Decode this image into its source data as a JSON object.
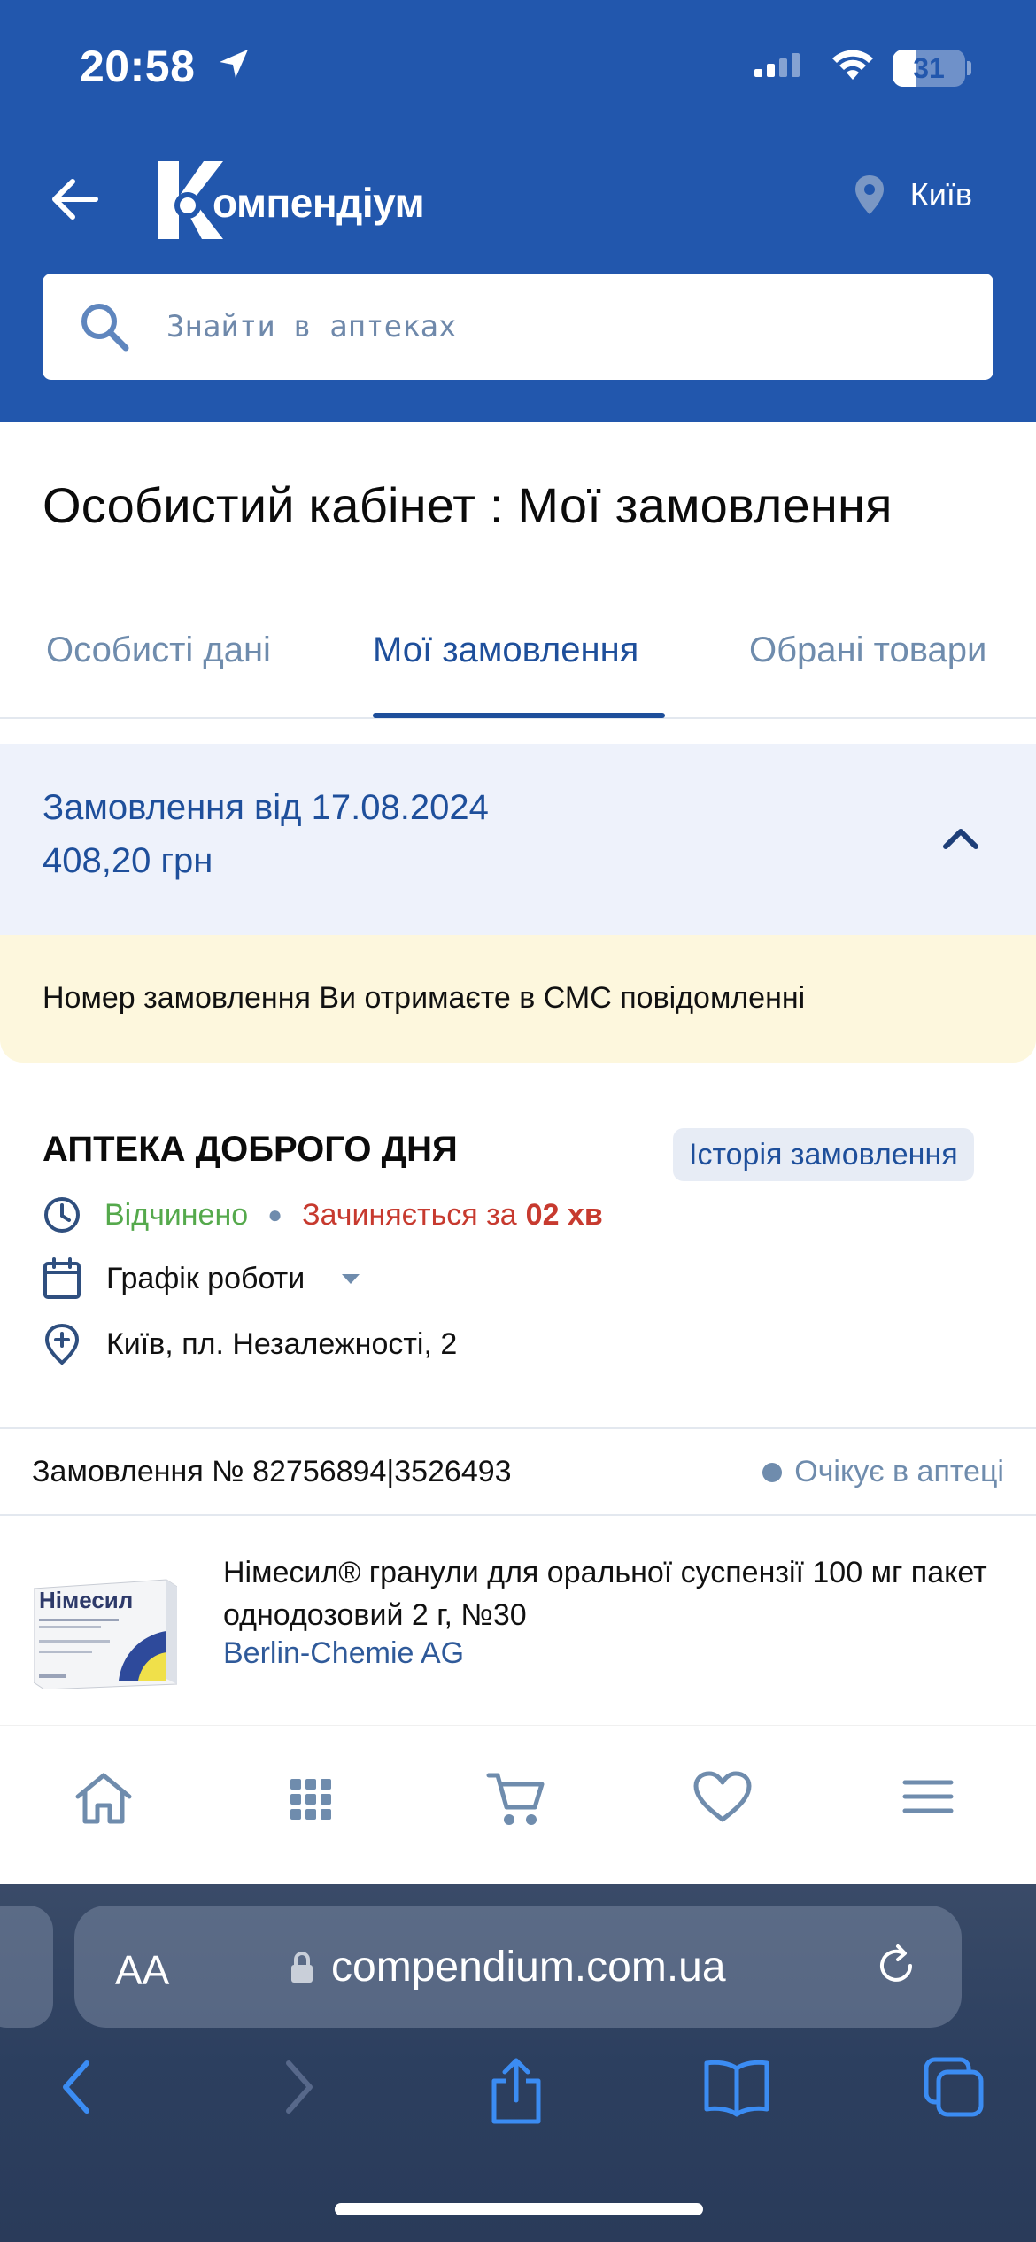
{
  "status_bar": {
    "time": "20:58",
    "battery": "31"
  },
  "header": {
    "logo_text": "омпендіум",
    "city": "Київ",
    "search_placeholder": "Знайти в аптеках"
  },
  "page": {
    "title": "Особистий кабінет : Мої замовлення"
  },
  "tabs": [
    {
      "label": "Особисті дані",
      "active": false
    },
    {
      "label": "Мої замовлення",
      "active": true
    },
    {
      "label": "Обрані товари",
      "active": false
    }
  ],
  "order": {
    "date_label": "Замовлення від 17.08.2024",
    "sum": "408,20 грн",
    "notice": "Номер замовлення Ви отримаєте в СМС повідомленні",
    "pharmacy": {
      "name": "АПТЕКА ДОБРОГО ДНЯ",
      "history_button": "Історія замовлення",
      "open_status": "Відчинено",
      "closing_text": "Зачиняється за",
      "closing_time": "02 хв",
      "schedule_label": "Графік роботи",
      "address": "Київ, пл. Незалежності, 2"
    },
    "number_label": "Замовлення № 82756894|3526493",
    "status": "Очікує в аптеці",
    "product": {
      "name": "Німесил® гранули для оральної суспензії 100 мг пакет однодозовий 2 г, №30",
      "manufacturer": "Berlin-Chemie AG",
      "package_brand": "Німесил"
    }
  },
  "bottom_nav": [
    "home-icon",
    "catalog-grid-icon",
    "cart-icon",
    "favorites-heart-icon",
    "menu-icon"
  ],
  "browser": {
    "aa_label": "AA",
    "url": "compendium.com.ua"
  },
  "colors": {
    "brand_blue": "#2257ad",
    "accent_blue": "#1e4f9b",
    "muted_blue": "#6f8cad",
    "open_green": "#55a94c",
    "closing_red": "#c73a2f",
    "notice_bg": "#fdf7dd",
    "order_bg": "#eef2fb"
  }
}
